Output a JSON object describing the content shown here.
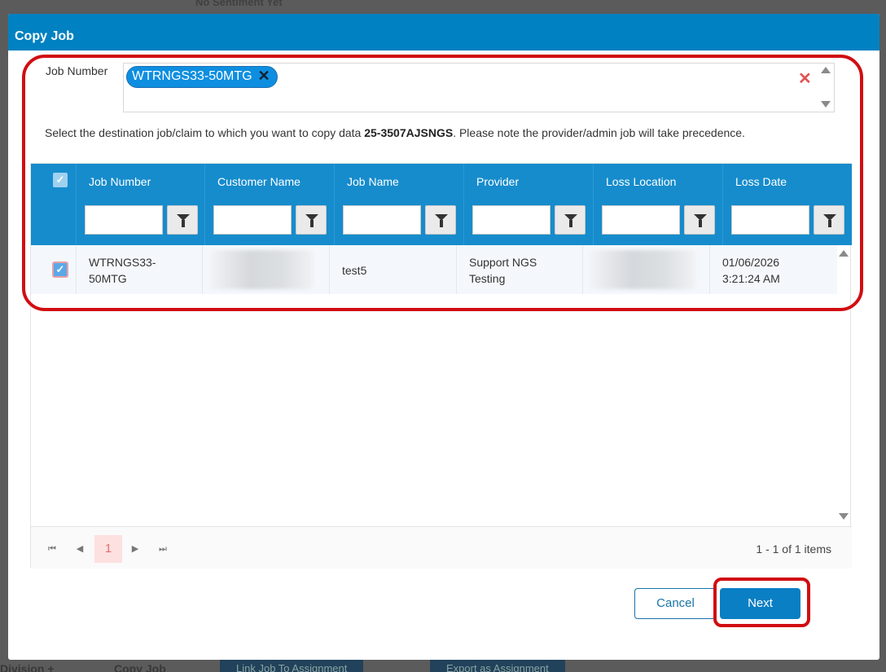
{
  "background": {
    "top_text": "No Sentiment Yet",
    "bottom_items": [
      "Division +",
      "Copy Job"
    ],
    "bottom_buttons": [
      "Link Job To Assignment",
      "Export as Assignment"
    ]
  },
  "dialog": {
    "title": "Copy Job",
    "job_number_label": "Job Number",
    "selected_chip": "WTRNGS33-50MTG",
    "note_prefix": "Select the destination job/claim to which you want to copy data ",
    "note_job": "25-3507AJSNGS",
    "note_suffix": ". Please note the provider/admin job will take precedence."
  },
  "grid": {
    "columns": [
      "Job Number",
      "Customer Name",
      "Job Name",
      "Provider",
      "Loss Location",
      "Loss Date"
    ],
    "rows": [
      {
        "checked": true,
        "job_number": "WTRNGS33-\n50MTG",
        "customer_name": "",
        "job_name": "test5",
        "provider": "Support NGS\nTesting",
        "loss_location": "",
        "loss_date": "01/06/2026\n3:21:24 AM"
      }
    ]
  },
  "pager": {
    "current_page": "1",
    "info": "1 - 1 of 1 items",
    "first_icon": "⏮",
    "prev_icon": "◀",
    "next_icon": "▶",
    "last_icon": "⏭"
  },
  "buttons": {
    "cancel": "Cancel",
    "next": "Next"
  },
  "icons": {
    "check": "✓",
    "remove": "✕"
  },
  "colors": {
    "titlebar": "#0081c2",
    "grid_header": "#168ccc",
    "annotation": "#d10d12",
    "primary_button": "#0b7fc4"
  }
}
